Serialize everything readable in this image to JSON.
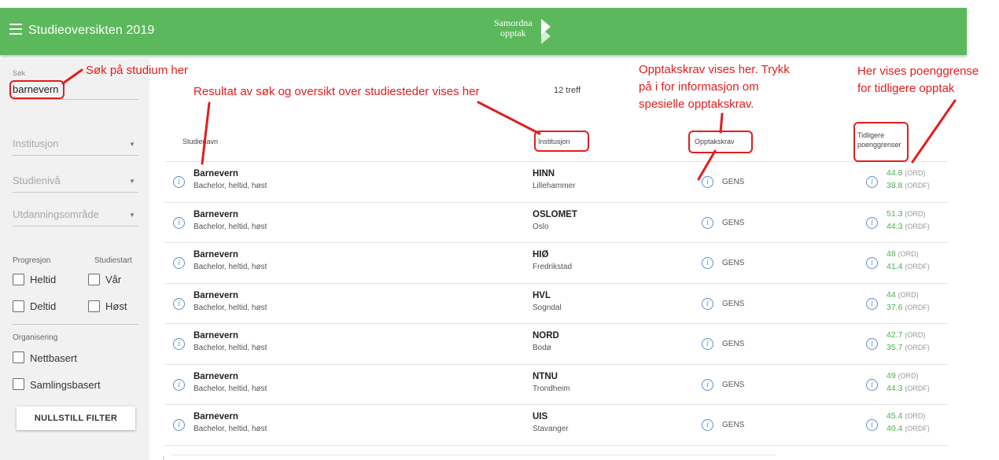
{
  "appbar": {
    "title": "Studieoversikten 2019",
    "logo_line1": "Samordna",
    "logo_line2": "opptak",
    "color": "#5cb85c"
  },
  "sidebar": {
    "search_label": "Søk",
    "search_value": "barnevern",
    "selects": [
      "Institusjon",
      "Studienivå",
      "Utdanningsområde"
    ],
    "progresjon_label": "Progresjon",
    "studiestart_label": "Studiestart",
    "progresjon_options": [
      "Heltid",
      "Deltid"
    ],
    "studiestart_options": [
      "Vår",
      "Høst"
    ],
    "organisering_label": "Organisering",
    "organisering_options": [
      "Nettbasert",
      "Samlingsbasert"
    ],
    "reset_label": "NULLSTILL FILTER"
  },
  "results": {
    "count": "12 treff",
    "headers": {
      "name": "Studienavn",
      "institution": "Institusjon",
      "requirements": "Opptakskrav",
      "scores": "Tidligere poenggrenser"
    },
    "rows": [
      {
        "name": "Barnevern",
        "desc": "Bachelor, heltid, høst",
        "inst": "HINN",
        "city": "Lillehammer",
        "req": "GENS",
        "ord": "44.8",
        "ordf": "38.8"
      },
      {
        "name": "Barnevern",
        "desc": "Bachelor, heltid, høst",
        "inst": "OSLOMET",
        "city": "Oslo",
        "req": "GENS",
        "ord": "51.3",
        "ordf": "44.3"
      },
      {
        "name": "Barnevern",
        "desc": "Bachelor, heltid, høst",
        "inst": "HIØ",
        "city": "Fredrikstad",
        "req": "GENS",
        "ord": "48",
        "ordf": "41.4"
      },
      {
        "name": "Barnevern",
        "desc": "Bachelor, heltid, høst",
        "inst": "HVL",
        "city": "Sogndal",
        "req": "GENS",
        "ord": "44",
        "ordf": "37.6"
      },
      {
        "name": "Barnevern",
        "desc": "Bachelor, heltid, høst",
        "inst": "NORD",
        "city": "Bodø",
        "req": "GENS",
        "ord": "42.7",
        "ordf": "35.7"
      },
      {
        "name": "Barnevern",
        "desc": "Bachelor, heltid, høst",
        "inst": "NTNU",
        "city": "Trondheim",
        "req": "GENS",
        "ord": "49",
        "ordf": "44.3"
      },
      {
        "name": "Barnevern",
        "desc": "Bachelor, heltid, høst",
        "inst": "UIS",
        "city": "Stavanger",
        "req": "GENS",
        "ord": "45.4",
        "ordf": "40.4"
      }
    ],
    "ord_tag": "(ORD)",
    "ordf_tag": "(ORDF)"
  },
  "annotations": {
    "search": "Søk på studium her",
    "results": "Resultat av søk og oversikt over studiesteder vises her",
    "requirements_1": "Opptakskrav vises her. Trykk",
    "requirements_2": "på i for informasjon om",
    "requirements_3": "spesielle opptakskrav.",
    "scores_1": "Her vises poenggrense",
    "scores_2": "for tidligere opptak",
    "color": "#e31d1d"
  }
}
